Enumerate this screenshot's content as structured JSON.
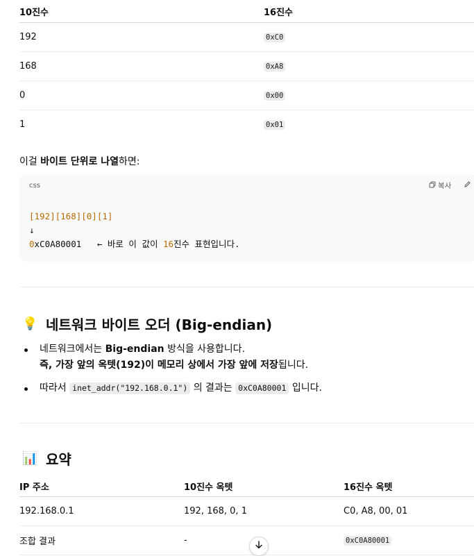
{
  "table1": {
    "headers": [
      "10진수",
      "16진수"
    ],
    "rows": [
      {
        "dec": "192",
        "hex": "0xC0"
      },
      {
        "dec": "168",
        "hex": "0xA8"
      },
      {
        "dec": "0",
        "hex": "0x00"
      },
      {
        "dec": "1",
        "hex": "0x01"
      }
    ]
  },
  "para": {
    "prefix": "이걸 ",
    "bold": "바이트 단위로 나열",
    "suffix": "하면:"
  },
  "codeblock": {
    "lang": "css",
    "copy_label": "복사",
    "line1": "[192][168][0][1]",
    "line2": "↓",
    "line3_a": "0",
    "line3_b": "xC0A80001   ← 바로 이 값이 ",
    "line3_c": "16",
    "line3_d": "진수 표현입니다."
  },
  "section1": {
    "emoji": "💡",
    "title": "네트워크 바이트 오더 (Big-endian)",
    "bullet1_a": "네트워크에서는 ",
    "bullet1_b": "Big-endian",
    "bullet1_c": " 방식을 사용합니다.",
    "bullet1_line2_bold": "즉, 가장 앞의 옥텟(192)이 메모리 상에서 가장 앞에 저장",
    "bullet1_line2_rest": "됩니다.",
    "bullet2_a": "따라서 ",
    "bullet2_code1": "inet_addr(\"192.168.0.1\")",
    "bullet2_b": " 의 결과는 ",
    "bullet2_code2": "0xC0A80001",
    "bullet2_c": " 입니다."
  },
  "section2": {
    "emoji": "📊",
    "title": "요약"
  },
  "table2": {
    "headers": [
      "IP 주소",
      "10진수 옥텟",
      "16진수 옥텟"
    ],
    "rows": [
      {
        "a": "192.168.0.1",
        "b": "192, 168, 0, 1",
        "c": "C0, A8, 00, 01"
      },
      {
        "a": "조합 결과",
        "b": "-",
        "c": "0xC0A80001"
      }
    ]
  },
  "scroll_icon": "arrow-down-icon"
}
